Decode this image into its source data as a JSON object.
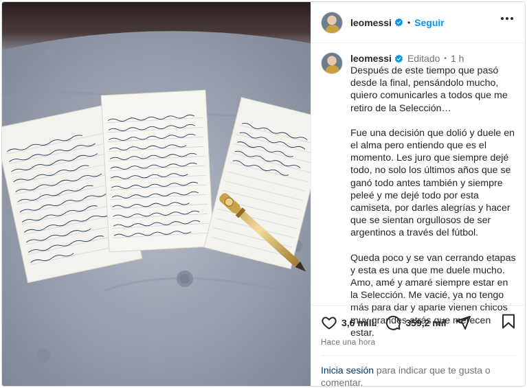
{
  "header": {
    "username": "leomessi",
    "follow_label": "Seguir"
  },
  "caption": {
    "username": "leomessi",
    "edited_label": "Editado",
    "time": "1 h",
    "paragraphs": [
      "Después de este tiempo que pasó desde la final, pensándolo mucho, quiero comunicarles a todos que me retiro de la Selección…",
      "Fue una decisión que dolió y duele en el alma pero entiendo que es el momento. Les juro que siempre dejé todo, no solo los últimos años que se ganó todo antes también y siempre peleé y me dejé todo por esta camiseta, por darles alegrías y hacer que se sientan orgullosos de ser argentinos a través del fútbol.",
      "Queda poco y se van cerrando etapas y esta es una que me duele mucho. Amo, amé y amaré siempre estar en la Selección. Me vacié, ya no tengo más para dar y aparte vienen chicos muy grandes atrás que merecen estar."
    ]
  },
  "actions": {
    "likes": "3,6 mill.",
    "comments": "359,2 mil",
    "time_ago": "Hace una hora",
    "login_link": "Inicia sesión",
    "login_rest": " para indicar que te gusta o comentar."
  },
  "colors": {
    "accent": "#0095f6",
    "verified": "#0095f6",
    "muted": "#737373",
    "text": "#262626"
  },
  "icons": [
    "verified-badge-icon",
    "more-options-icon",
    "heart-icon",
    "comment-icon",
    "share-icon",
    "bookmark-icon"
  ]
}
